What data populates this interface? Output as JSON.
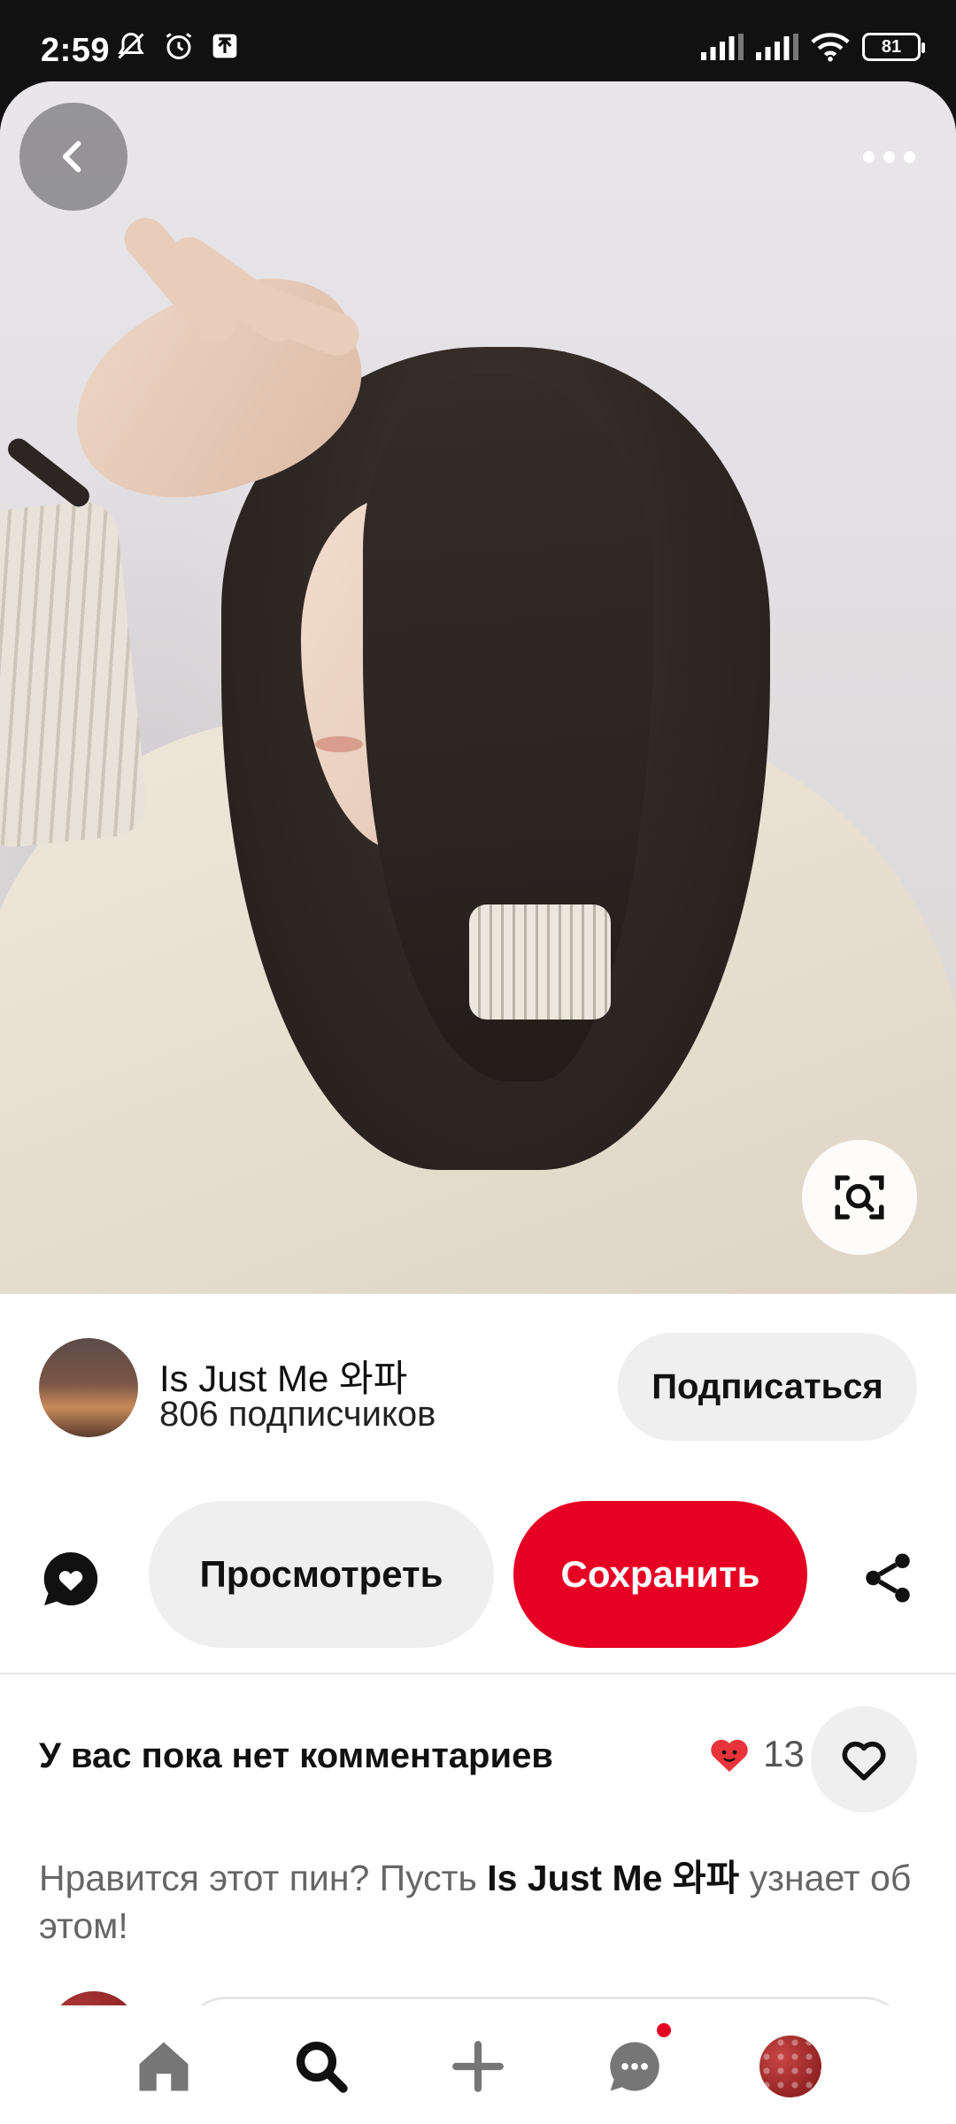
{
  "status_bar": {
    "time": "2:59",
    "battery": "81",
    "icons": [
      "muted-bell-icon",
      "alarm-icon",
      "upload-icon",
      "signal-icon",
      "signal-icon",
      "wifi-icon",
      "battery-icon"
    ]
  },
  "pin": {
    "top_icons": [
      "back-arrow-icon",
      "more-dots-icon"
    ],
    "visual_search_icon": "visual-search-icon"
  },
  "creator": {
    "name": "Is Just Me 와파",
    "followers": "806 подписчиков",
    "follow_label": "Подписаться"
  },
  "actions": {
    "view_label": "Просмотреть",
    "save_label": "Сохранить",
    "save_color": "#e60023"
  },
  "comments": {
    "title": "У вас пока нет комментариев",
    "reaction_count": "13",
    "prompt_prefix": "Нравится этот пин? Пусть ",
    "prompt_name": "Is Just Me 와파",
    "prompt_suffix": " узнает об этом!"
  },
  "bottom_nav": {
    "items": [
      "home-icon",
      "search-icon",
      "create-plus-icon",
      "messages-icon",
      "profile-avatar"
    ]
  }
}
